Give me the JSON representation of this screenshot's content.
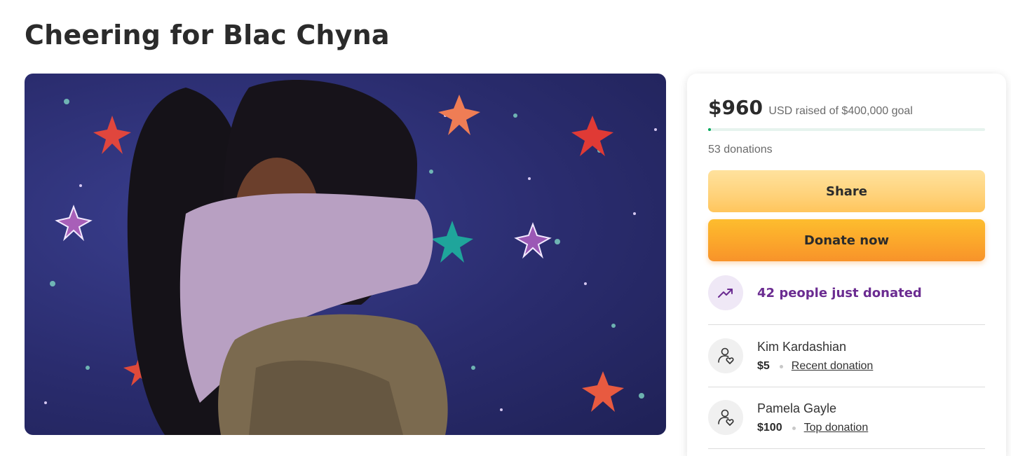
{
  "page": {
    "title": "Cheering for Blac Chyna"
  },
  "hero": {
    "image": "two-people-hugging-photo"
  },
  "card": {
    "raised_amount": "$960",
    "goal_text": "USD raised of $400,000 goal",
    "progress_fraction": 0.0024,
    "donations_count": "53 donations",
    "share_label": "Share",
    "donate_label": "Donate now",
    "trend_label": "42 people just donated",
    "colors": {
      "progress": "#02a95c",
      "trend_text": "#6b2c91",
      "donate": "#f8932a",
      "share": "#ffd27a"
    },
    "donors": [
      {
        "name": "Kim Kardashian",
        "amount": "$5",
        "tag": "Recent donation"
      },
      {
        "name": "Pamela Gayle",
        "amount": "$100",
        "tag": "Top donation"
      }
    ]
  }
}
